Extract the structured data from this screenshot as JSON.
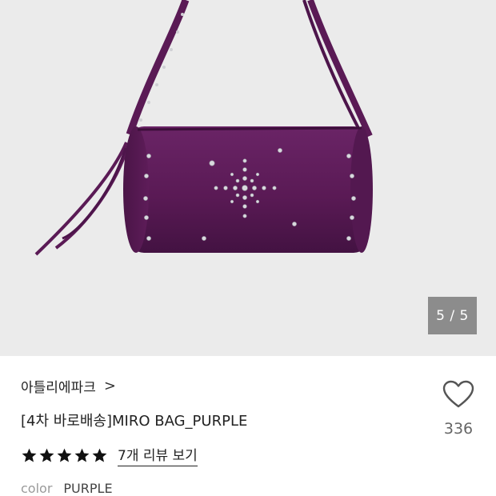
{
  "gallery": {
    "counter": "5 / 5",
    "image_subject": "purple studded shoulder bag"
  },
  "product": {
    "brand": "아틀리에파크",
    "brand_chevron": ">",
    "title": "[4차 바로배송]MIRO BAG_PURPLE",
    "rating": 5,
    "review_link": "7개 리뷰 보기",
    "option_label": "color",
    "option_value": "PURPLE"
  },
  "like": {
    "icon": "heart-outline-icon",
    "count": "336"
  },
  "colors": {
    "bag_purple": "#5a1a55",
    "background_gray": "#ebebeb",
    "counter_bg": "#8c8c8c",
    "star": "#111111"
  }
}
